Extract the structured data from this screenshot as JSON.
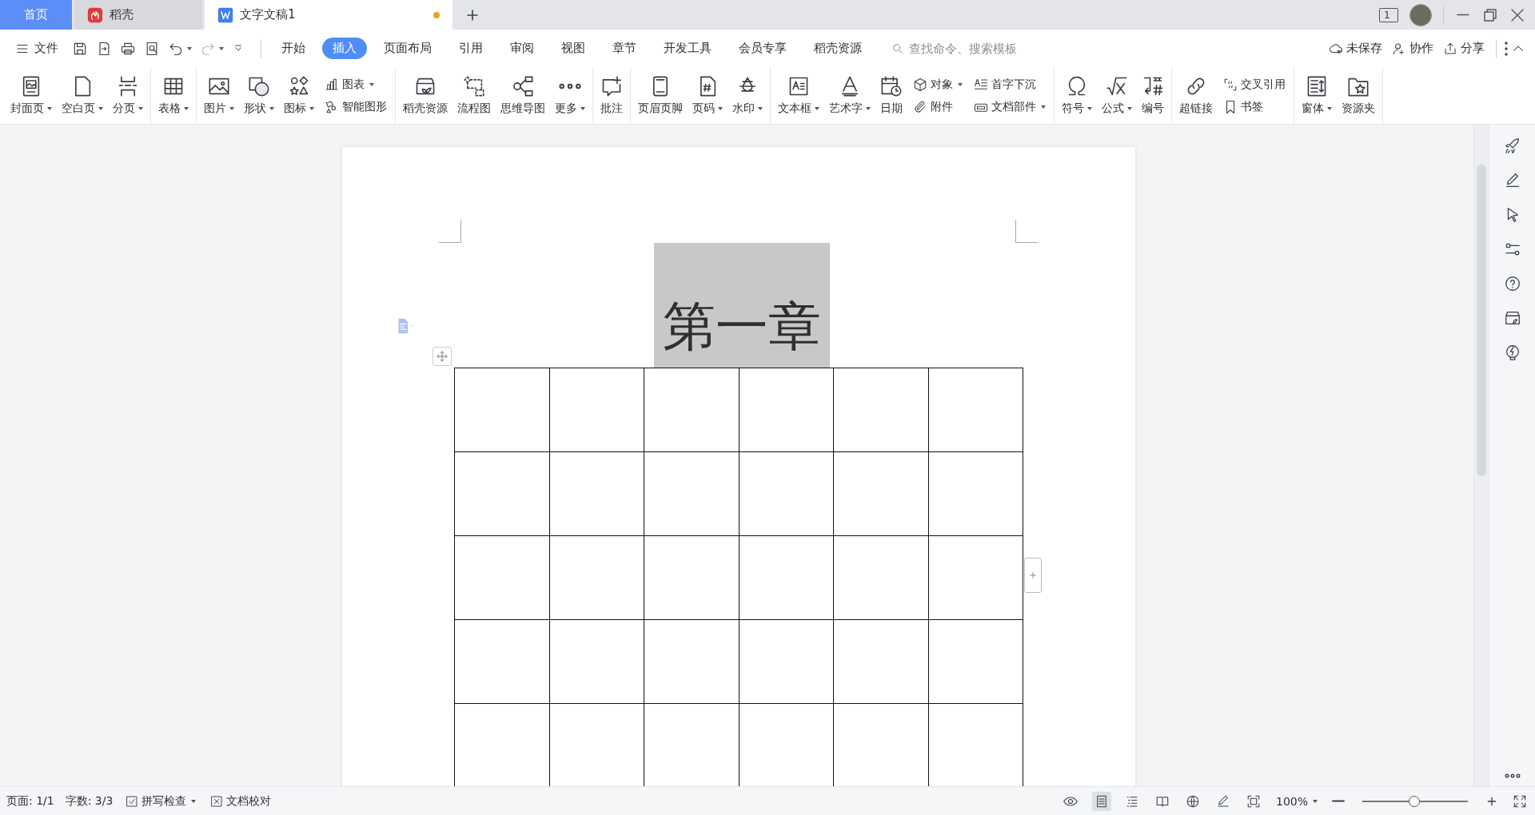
{
  "title_bar": {
    "tabs": [
      {
        "kind": "home",
        "label": "首页",
        "selected": false
      },
      {
        "kind": "app",
        "label": "稻壳",
        "selected": false
      },
      {
        "kind": "doc",
        "label": "文字文稿1",
        "selected": true,
        "modified": true
      }
    ],
    "layout_badge": "1"
  },
  "menu_bar": {
    "file": "文件",
    "undo": {
      "disabled": false
    },
    "redo": {
      "disabled": true
    },
    "tabs": [
      {
        "label": "开始",
        "selected": false
      },
      {
        "label": "插入",
        "selected": true
      },
      {
        "label": "页面布局",
        "selected": false
      },
      {
        "label": "引用",
        "selected": false
      },
      {
        "label": "审阅",
        "selected": false
      },
      {
        "label": "视图",
        "selected": false
      },
      {
        "label": "章节",
        "selected": false
      },
      {
        "label": "开发工具",
        "selected": false
      },
      {
        "label": "会员专享",
        "selected": false
      },
      {
        "label": "稻壳资源",
        "selected": false
      }
    ],
    "search": {
      "placeholder": "查找命令、搜索模板"
    },
    "actions": [
      "未保存",
      "协作",
      "分享"
    ]
  },
  "ribbon": {
    "groups": [
      {
        "items": [
          {
            "kind": "large",
            "label": "封面页",
            "dropdown": true
          },
          {
            "kind": "large",
            "label": "空白页",
            "dropdown": true
          },
          {
            "kind": "large",
            "label": "分页",
            "dropdown": true
          }
        ]
      },
      {
        "items": [
          {
            "kind": "large",
            "label": "表格",
            "dropdown": true
          }
        ]
      },
      {
        "items": [
          {
            "kind": "large",
            "label": "图片",
            "dropdown": true
          },
          {
            "kind": "large",
            "label": "形状",
            "dropdown": true
          },
          {
            "kind": "large",
            "label": "图标",
            "dropdown": true
          },
          {
            "kind": "stack",
            "items": [
              {
                "label": "图表",
                "dropdown": true
              },
              {
                "label": "智能图形",
                "dropdown": false
              }
            ]
          }
        ]
      },
      {
        "items": [
          {
            "kind": "large",
            "label": "稻壳资源",
            "dropdown": false
          },
          {
            "kind": "large",
            "label": "流程图",
            "dropdown": false
          },
          {
            "kind": "large",
            "label": "思维导图",
            "dropdown": false
          },
          {
            "kind": "large",
            "label": "更多",
            "dropdown": true
          }
        ]
      },
      {
        "items": [
          {
            "kind": "large",
            "label": "批注",
            "dropdown": false
          }
        ]
      },
      {
        "items": [
          {
            "kind": "large",
            "label": "页眉页脚",
            "dropdown": false
          },
          {
            "kind": "large",
            "label": "页码",
            "dropdown": true
          },
          {
            "kind": "large",
            "label": "水印",
            "dropdown": true
          }
        ]
      },
      {
        "items": [
          {
            "kind": "large",
            "label": "文本框",
            "dropdown": true
          },
          {
            "kind": "large",
            "label": "艺术字",
            "dropdown": true
          },
          {
            "kind": "large",
            "label": "日期",
            "dropdown": false
          },
          {
            "kind": "stack",
            "items": [
              {
                "label": "对象",
                "dropdown": true
              },
              {
                "label": "附件",
                "dropdown": false
              }
            ]
          },
          {
            "kind": "stack",
            "items": [
              {
                "label": "首字下沉",
                "dropdown": false
              },
              {
                "label": "文档部件",
                "dropdown": true
              }
            ]
          }
        ]
      },
      {
        "items": [
          {
            "kind": "large",
            "label": "符号",
            "dropdown": true
          },
          {
            "kind": "large",
            "label": "公式",
            "dropdown": true
          },
          {
            "kind": "large",
            "label": "编号",
            "dropdown": false
          }
        ]
      },
      {
        "items": [
          {
            "kind": "large",
            "label": "超链接",
            "dropdown": false
          },
          {
            "kind": "stack",
            "items": [
              {
                "label": "交叉引用",
                "dropdown": false
              },
              {
                "label": "书签",
                "dropdown": false
              }
            ]
          }
        ]
      },
      {
        "items": [
          {
            "kind": "large",
            "label": "窗体",
            "dropdown": true
          },
          {
            "kind": "large",
            "label": "资源夹",
            "dropdown": false
          }
        ]
      }
    ]
  },
  "document": {
    "heading": "第一章",
    "heading_highlighted": true,
    "table": {
      "rows": [
        {
          "cells": [
            {},
            {},
            {},
            {},
            {},
            {}
          ]
        },
        {
          "cells": [
            {},
            {},
            {},
            {},
            {},
            {}
          ]
        },
        {
          "cells": [
            {},
            {},
            {},
            {},
            {},
            {}
          ]
        },
        {
          "cells": [
            {},
            {},
            {},
            {},
            {},
            {}
          ]
        },
        {
          "cells": [
            {},
            {},
            {},
            {},
            {},
            {}
          ]
        }
      ]
    }
  },
  "status_bar": {
    "page": "页面: 1/1",
    "words": "字数: 3/3",
    "spell_check": "拼写检查",
    "proofread": "文档校对",
    "views": [
      {
        "selected": true
      },
      {
        "selected": false
      },
      {
        "selected": false
      },
      {
        "selected": false
      }
    ],
    "zoom": "100%",
    "zoom_slider": {
      "level": 0.5
    }
  }
}
